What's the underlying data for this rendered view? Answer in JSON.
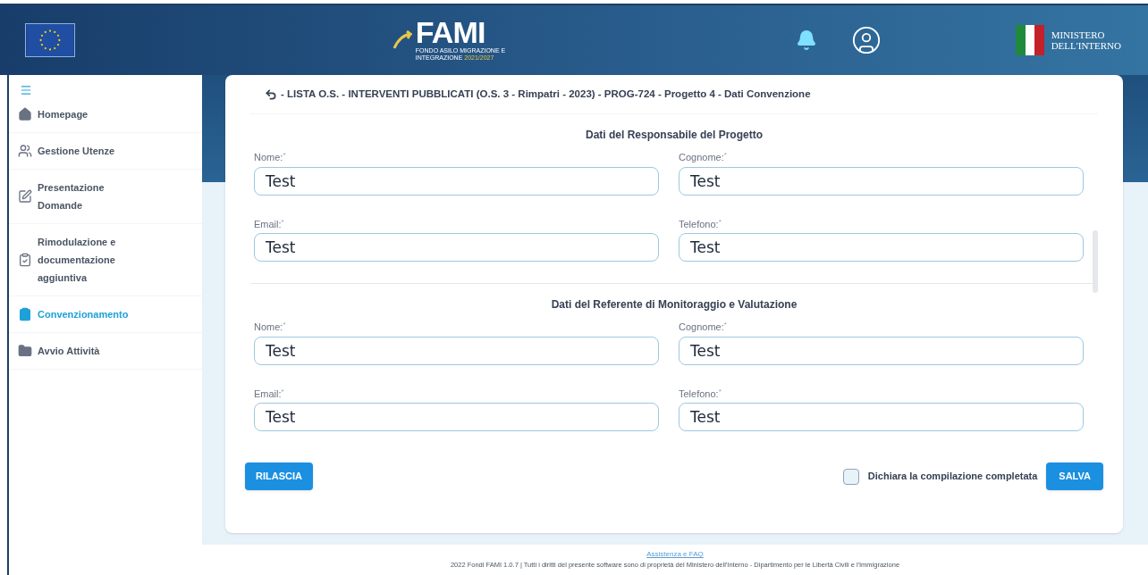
{
  "header": {
    "logo": {
      "title": "FAMI",
      "subtitle": "FONDO ASILO MIGRAZIONE E INTEGRAZIONE",
      "years": "2021/2027"
    },
    "ministry": [
      "MINISTERO",
      "DELL'INTERNO"
    ]
  },
  "sidebar": {
    "items": [
      {
        "label": "Homepage",
        "kind": "home",
        "selected": false
      },
      {
        "label": "Gestione Utenze",
        "kind": "users",
        "selected": false
      },
      {
        "label": "Presentazione Domande",
        "kind": "edit",
        "selected": false
      },
      {
        "label": "Rimodulazione e documentazione aggiuntiva",
        "kind": "clipboard",
        "selected": false
      },
      {
        "label": "Convenzionamento",
        "kind": "clipboard-solid",
        "selected": true
      },
      {
        "label": "Avvio Attività",
        "kind": "folder",
        "selected": false
      }
    ]
  },
  "breadcrumb": "- LISTA O.S. - INTERVENTI PUBBLICATI (O.S. 3 - Rimpatri - 2023) - PROG-724 - Progetto 4 - Dati Convenzione",
  "sections": [
    {
      "title": "Dati del Responsabile del Progetto",
      "fields": [
        {
          "label": "Nome:",
          "value": "Test"
        },
        {
          "label": "Cognome:",
          "value": "Test"
        },
        {
          "label": "Email:",
          "value": "Test"
        },
        {
          "label": "Telefono:",
          "value": "Test"
        }
      ]
    },
    {
      "title": "Dati del Referente di Monitoraggio e Valutazione",
      "fields": [
        {
          "label": "Nome:",
          "value": "Test"
        },
        {
          "label": "Cognome:",
          "value": "Test"
        },
        {
          "label": "Email:",
          "value": "Test"
        },
        {
          "label": "Telefono:",
          "value": "Test"
        }
      ]
    }
  ],
  "required_mark": "*",
  "actions": {
    "release": "RILASCIA",
    "declare": {
      "label": "Dichiara la compilazione completata",
      "checked": false
    },
    "save": "SALVA"
  },
  "footer": {
    "link": "Assistenza e FAQ",
    "text": "2022 Fondi FAMI 1.0.7 | Tutti i diritti del presente software sono di proprietà del Ministero dell'Interno - Dipartimento per le Libertà Civili e l'Immigrazione"
  }
}
